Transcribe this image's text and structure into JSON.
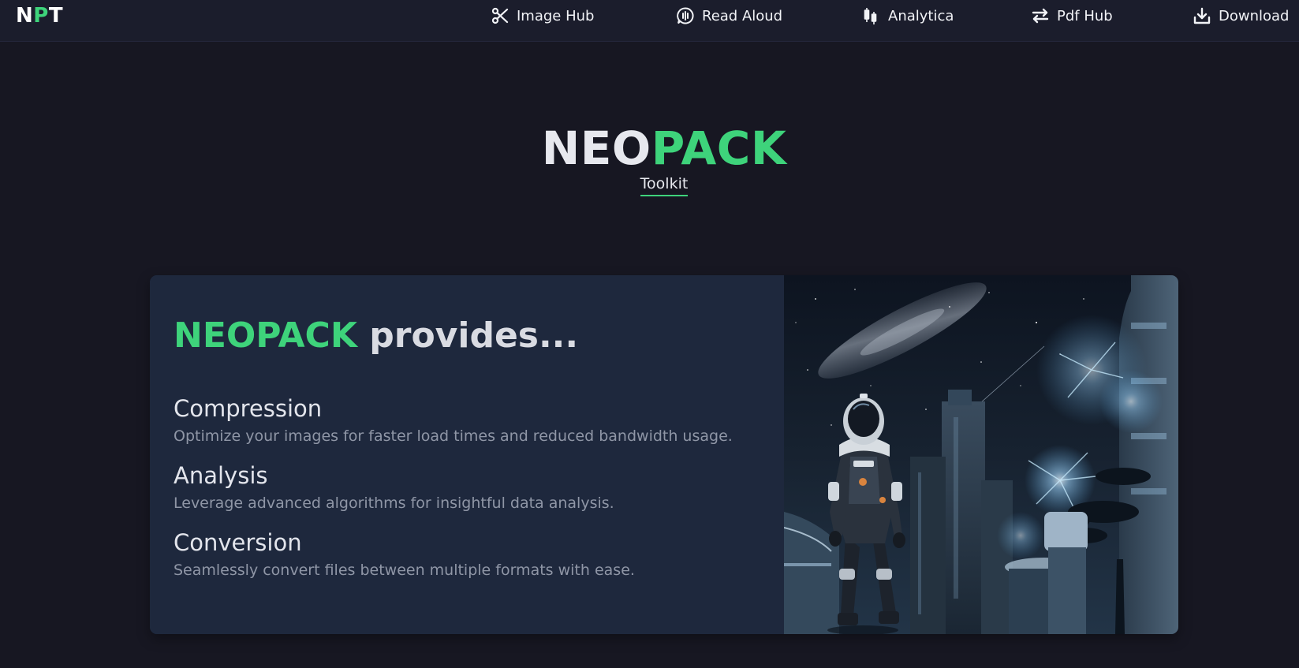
{
  "nav": {
    "logo": {
      "letters": [
        "N",
        "P",
        "T"
      ]
    },
    "items": [
      {
        "label": "Image Hub",
        "icon": "scissors-icon"
      },
      {
        "label": "Read Aloud",
        "icon": "audio-wave-icon"
      },
      {
        "label": "Analytica",
        "icon": "candlestick-chart-icon"
      },
      {
        "label": "Pdf Hub",
        "icon": "swap-arrows-icon"
      },
      {
        "label": "Download",
        "icon": "download-icon"
      }
    ]
  },
  "hero": {
    "title_part1": "NEO",
    "title_part2": "PACK",
    "subtitle": "Toolkit"
  },
  "card": {
    "heading_brand": "NEOPACK",
    "heading_rest": " provides...",
    "features": [
      {
        "title": "Compression",
        "description": "Optimize your images for faster load times and reduced bandwidth usage."
      },
      {
        "title": "Analysis",
        "description": "Leverage advanced algorithms for insightful data analysis."
      },
      {
        "title": "Conversion",
        "description": "Seamlessly convert files between multiple formats with ease."
      }
    ],
    "image_subject": "astronaut-in-futuristic-city-illustration"
  },
  "colors": {
    "background": "#171722",
    "navbar": "#1b1d2c",
    "accent_green": "#3ed37b",
    "card": "#1e283d",
    "text_light": "#e6e8ee",
    "text_muted": "#8f96a6"
  }
}
